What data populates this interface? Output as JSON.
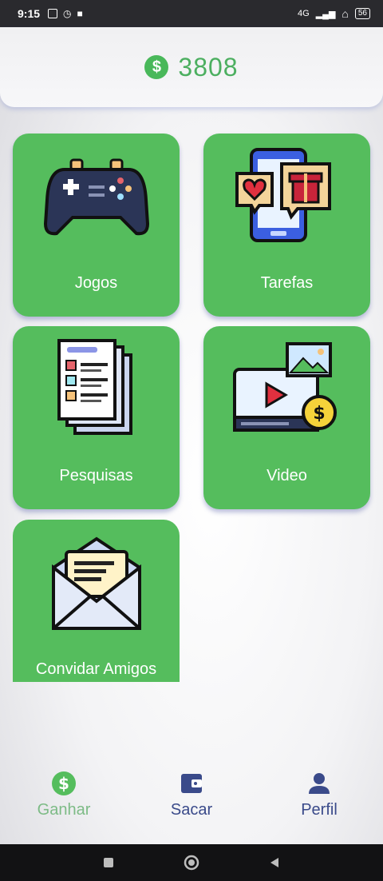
{
  "status_bar": {
    "time": "9:15",
    "network": "4G",
    "battery": "56"
  },
  "header": {
    "currency_symbol": "$",
    "balance": "3808"
  },
  "cards": [
    {
      "label": "Jogos",
      "icon": "gamepad-icon"
    },
    {
      "label": "Tarefas",
      "icon": "phone-gift-icon"
    },
    {
      "label": "Pesquisas",
      "icon": "survey-icon"
    },
    {
      "label": "Video",
      "icon": "video-money-icon"
    },
    {
      "label": "Convidar Amigos",
      "icon": "envelope-icon"
    }
  ],
  "bottom_nav": [
    {
      "label": "Ganhar",
      "icon": "dollar-coin-icon",
      "active": true
    },
    {
      "label": "Sacar",
      "icon": "wallet-icon",
      "active": false
    },
    {
      "label": "Perfil",
      "icon": "person-icon",
      "active": false
    }
  ],
  "colors": {
    "accent_green": "#55bd5d",
    "nav_blue": "#3a4a8a",
    "nav_active": "#7dbb86"
  }
}
